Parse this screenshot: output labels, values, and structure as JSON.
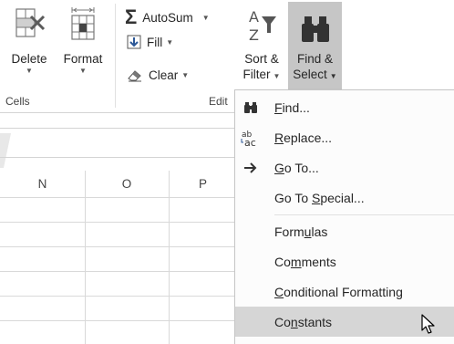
{
  "ribbon": {
    "cells_group": {
      "label": "Cells",
      "delete_label": "Delete",
      "format_label": "Format"
    },
    "editing_group": {
      "label_visible": "Edit",
      "autosum_label": "AutoSum",
      "fill_label": "Fill",
      "clear_label": "Clear",
      "sort_label_line1": "Sort &",
      "sort_label_line2": "Filter",
      "find_label_line1": "Find &",
      "find_label_line2": "Select"
    }
  },
  "grid": {
    "columns": [
      "N",
      "O",
      "P"
    ]
  },
  "menu": {
    "items": [
      {
        "icon": "binoculars-icon",
        "label_pre": "",
        "label_u": "F",
        "label_post": "ind..."
      },
      {
        "icon": "replace-icon",
        "label_pre": "",
        "label_u": "R",
        "label_post": "eplace..."
      },
      {
        "icon": "arrow-right-icon",
        "label_pre": "",
        "label_u": "G",
        "label_post": "o To..."
      },
      {
        "icon": "",
        "label_pre": "Go To ",
        "label_u": "S",
        "label_post": "pecial..."
      },
      {
        "icon": "",
        "label_pre": "Form",
        "label_u": "u",
        "label_post": "las"
      },
      {
        "icon": "",
        "label_pre": "Co",
        "label_u": "m",
        "label_post": "ments"
      },
      {
        "icon": "",
        "label_pre": "",
        "label_u": "C",
        "label_post": "onditional Formatting"
      },
      {
        "icon": "",
        "label_pre": "Co",
        "label_u": "n",
        "label_post": "stants"
      }
    ]
  }
}
